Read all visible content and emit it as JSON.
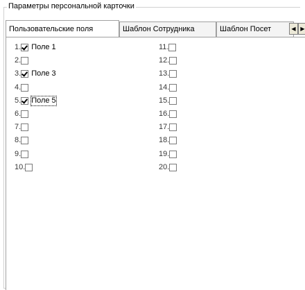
{
  "group": {
    "title": "Параметры персональной карточки"
  },
  "tabs": [
    {
      "label": "Пользовательские поля",
      "active": true
    },
    {
      "label": "Шаблон Сотрудника",
      "active": false
    },
    {
      "label": "Шаблон Посет",
      "active": false
    }
  ],
  "tab_scroll": {
    "left_icon": "arrow-left-icon",
    "right_icon": "arrow-right-icon"
  },
  "fields_left": [
    {
      "num": "1.",
      "checked": true,
      "label": "Поле 1"
    },
    {
      "num": "2.",
      "checked": false,
      "label": ""
    },
    {
      "num": "3.",
      "checked": true,
      "label": "Поле 3"
    },
    {
      "num": "4.",
      "checked": false,
      "label": ""
    },
    {
      "num": "5.",
      "checked": true,
      "label": "Поле 5",
      "focused": true
    },
    {
      "num": "6.",
      "checked": false,
      "label": ""
    },
    {
      "num": "7.",
      "checked": false,
      "label": ""
    },
    {
      "num": "8.",
      "checked": false,
      "label": ""
    },
    {
      "num": "9.",
      "checked": false,
      "label": ""
    },
    {
      "num": "10.",
      "checked": false,
      "label": ""
    }
  ],
  "fields_right": [
    {
      "num": "11.",
      "checked": false,
      "label": ""
    },
    {
      "num": "12.",
      "checked": false,
      "label": ""
    },
    {
      "num": "13.",
      "checked": false,
      "label": ""
    },
    {
      "num": "14.",
      "checked": false,
      "label": ""
    },
    {
      "num": "15.",
      "checked": false,
      "label": ""
    },
    {
      "num": "16.",
      "checked": false,
      "label": ""
    },
    {
      "num": "17.",
      "checked": false,
      "label": ""
    },
    {
      "num": "18.",
      "checked": false,
      "label": ""
    },
    {
      "num": "19.",
      "checked": false,
      "label": ""
    },
    {
      "num": "20.",
      "checked": false,
      "label": ""
    }
  ]
}
